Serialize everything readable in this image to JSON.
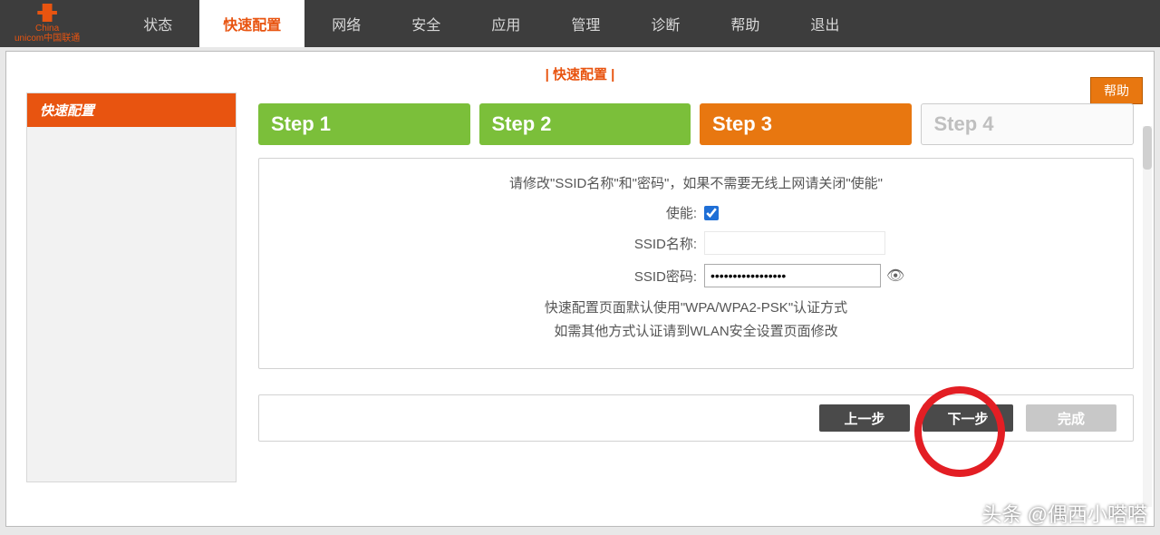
{
  "brand": {
    "line1": "China",
    "line2": "unicom中国联通"
  },
  "nav": [
    {
      "label": "状态",
      "active": false
    },
    {
      "label": "快速配置",
      "active": true
    },
    {
      "label": "网络",
      "active": false
    },
    {
      "label": "安全",
      "active": false
    },
    {
      "label": "应用",
      "active": false
    },
    {
      "label": "管理",
      "active": false
    },
    {
      "label": "诊断",
      "active": false
    },
    {
      "label": "帮助",
      "active": false
    },
    {
      "label": "退出",
      "active": false
    }
  ],
  "breadcrumb": "| 快速配置 |",
  "help_button": "帮助",
  "sidebar": {
    "items": [
      {
        "label": "快速配置"
      }
    ]
  },
  "steps": [
    {
      "label": "Step 1",
      "state": "done"
    },
    {
      "label": "Step 2",
      "state": "done"
    },
    {
      "label": "Step 3",
      "state": "active"
    },
    {
      "label": "Step 4",
      "state": "future"
    }
  ],
  "form": {
    "instruction": "请修改\"SSID名称\"和\"密码\"，如果不需要无线上网请关闭\"使能\"",
    "enable_label": "使能:",
    "enable_checked": true,
    "ssid_name_label": "SSID名称:",
    "ssid_name_value": "",
    "ssid_pwd_label": "SSID密码:",
    "ssid_pwd_value": "•••••••••••••••••",
    "hint_line1": "快速配置页面默认使用\"WPA/WPA2-PSK\"认证方式",
    "hint_line2": "如需其他方式认证请到WLAN安全设置页面修改"
  },
  "buttons": {
    "prev": "上一步",
    "next": "下一步",
    "finish": "完成"
  },
  "watermark": "头条 @偶西小嗒嗒"
}
